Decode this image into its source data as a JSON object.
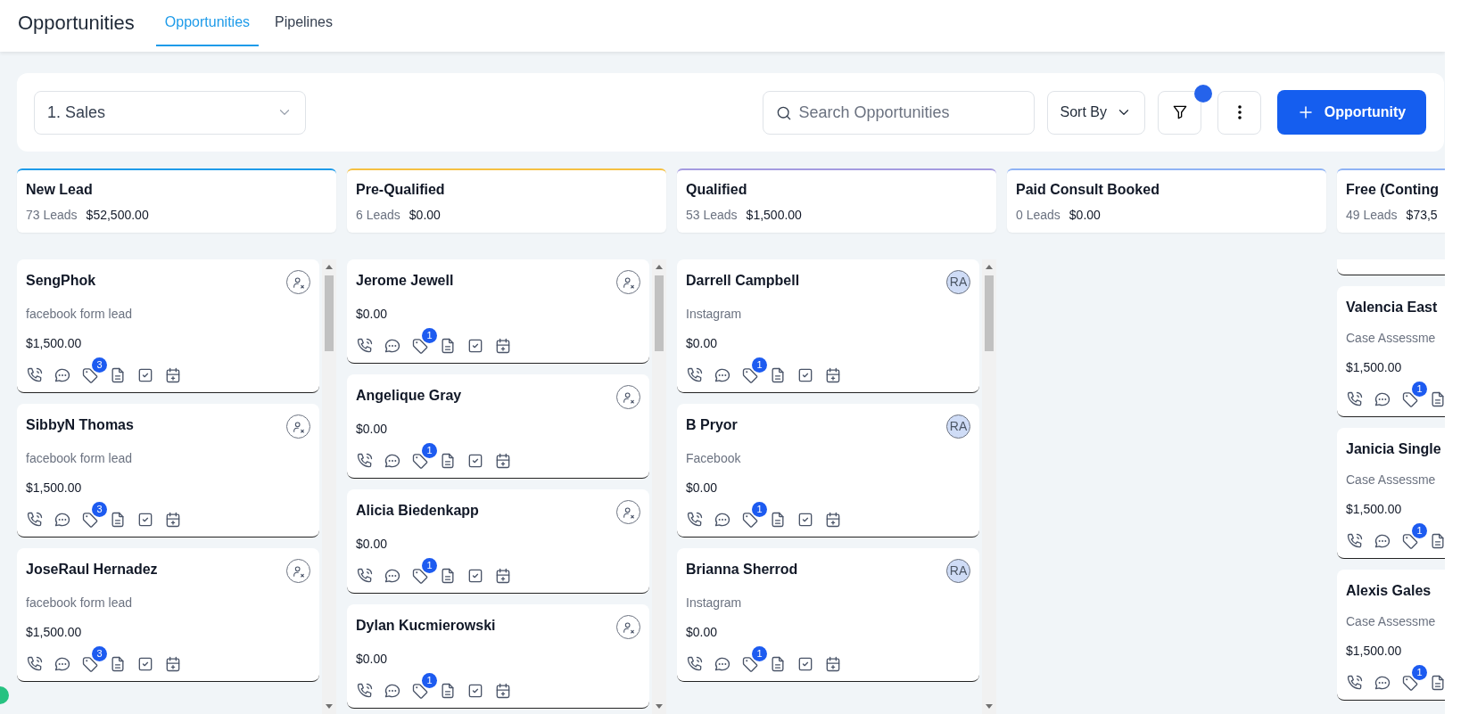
{
  "header": {
    "title": "Opportunities",
    "tabs": [
      {
        "label": "Opportunities",
        "selected": true
      },
      {
        "label": "Pipelines",
        "selected": false
      }
    ]
  },
  "toolbar": {
    "pipeline": "1. Sales",
    "search": {
      "placeholder": "Search Opportunities"
    },
    "sort": "Sort By",
    "filter_active": true,
    "add_button": "Opportunity"
  },
  "stages": [
    {
      "title": "New Lead",
      "count": "73 Leads",
      "total": "$52,500.00",
      "color": "#1e9be9",
      "scrollable": true,
      "cards": [
        {
          "name": "SengPhok",
          "source": "facebook form lead",
          "amount": "$1,500.00",
          "tags": "3",
          "owner": {
            "kind": "unassigned"
          }
        },
        {
          "name": "SibbyN Thomas",
          "source": "facebook form lead",
          "amount": "$1,500.00",
          "tags": "3",
          "owner": {
            "kind": "unassigned"
          }
        },
        {
          "name": "JoseRaul Hernadez",
          "source": "facebook form lead",
          "amount": "$1,500.00",
          "tags": "3",
          "owner": {
            "kind": "unassigned"
          }
        }
      ]
    },
    {
      "title": "Pre-Qualified",
      "count": "6 Leads",
      "total": "$0.00",
      "color": "#f5c142",
      "scrollable": true,
      "cards": [
        {
          "name": "Jerome Jewell",
          "amount": "$0.00",
          "tags": "1",
          "owner": {
            "kind": "unassigned"
          }
        },
        {
          "name": "Angelique Gray",
          "amount": "$0.00",
          "tags": "1",
          "owner": {
            "kind": "unassigned"
          }
        },
        {
          "name": "Alicia Biedenkapp",
          "amount": "$0.00",
          "tags": "1",
          "owner": {
            "kind": "unassigned"
          }
        },
        {
          "name": "Dylan Kucmierowski",
          "amount": "$0.00",
          "tags": "1",
          "owner": {
            "kind": "unassigned"
          }
        }
      ]
    },
    {
      "title": "Qualified",
      "count": "53 Leads",
      "total": "$1,500.00",
      "color": "#a59be0",
      "scrollable": true,
      "cards": [
        {
          "name": "Darrell Campbell",
          "source": "Instagram",
          "amount": "$0.00",
          "tags": "1",
          "owner": {
            "kind": "initials",
            "text": "RA"
          }
        },
        {
          "name": "B Pryor",
          "source": "Facebook",
          "amount": "$0.00",
          "tags": "1",
          "owner": {
            "kind": "initials",
            "text": "RA"
          }
        },
        {
          "name": "Brianna Sherrod",
          "source": "Instagram",
          "amount": "$0.00",
          "tags": "1",
          "owner": {
            "kind": "initials",
            "text": "RA"
          }
        }
      ]
    },
    {
      "title": "Paid Consult Booked",
      "count": "0 Leads",
      "total": "$0.00",
      "color": "#8fb3f5",
      "scrollable": false
    },
    {
      "title": "Free (Conting",
      "count": "49 Leads",
      "total": "$73,5",
      "color": "#8fb3f5",
      "scrollable": false,
      "scrolled": true,
      "cards": [
        {
          "name": "Valencia East",
          "source": "Case Assessme",
          "amount": "$1,500.00",
          "tags": "1"
        },
        {
          "name": "Janicia Single",
          "source": "Case Assessme",
          "amount": "$1,500.00",
          "tags": "1"
        },
        {
          "name": "Alexis Gales",
          "source": "Case Assessme",
          "amount": "$1,500.00",
          "tags": "1"
        }
      ]
    }
  ]
}
